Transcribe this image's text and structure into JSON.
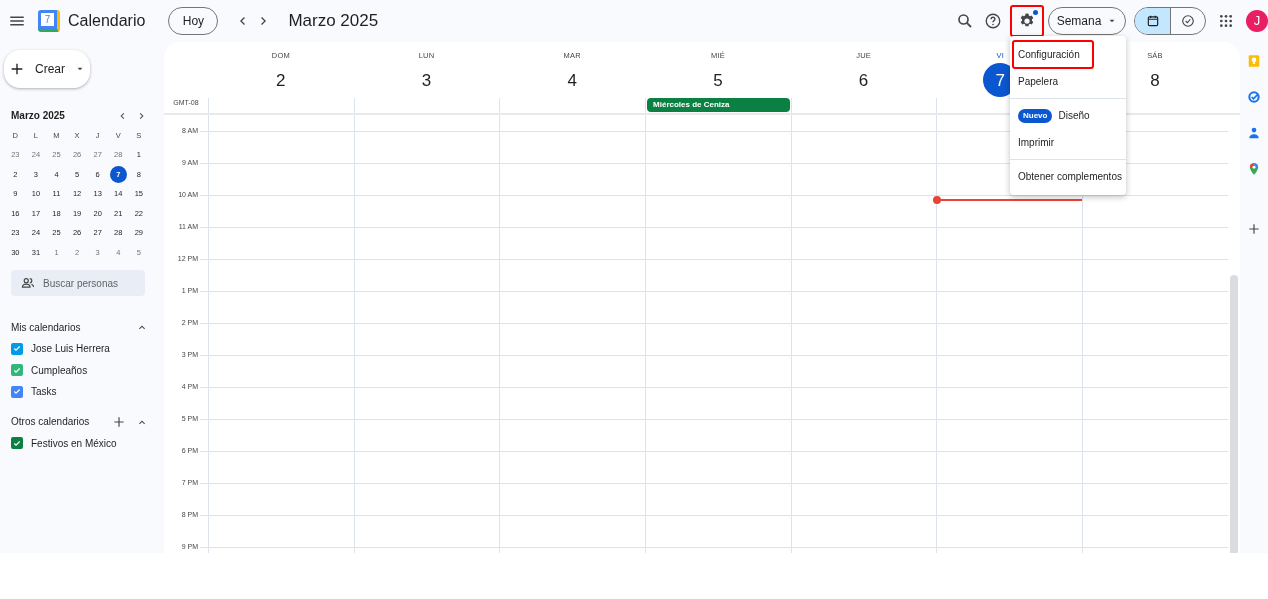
{
  "app": {
    "title": "Calendario",
    "logo_digit": "7"
  },
  "toolbar": {
    "today_button": "Hoy",
    "period_title": "Marzo 2025",
    "view_selector": "Semana",
    "settings_highlighted": true,
    "settings_badge": true,
    "avatar_letter": "J",
    "view_toggle": [
      {
        "kind": "calendar",
        "selected": true
      },
      {
        "kind": "tasks",
        "selected": false
      }
    ]
  },
  "sidebar": {
    "create_button": "Crear",
    "mini_calendar": {
      "title": "Marzo 2025",
      "weekdays": [
        "D",
        "L",
        "M",
        "X",
        "J",
        "V",
        "S"
      ],
      "weeks": [
        [
          {
            "day": "23",
            "muted": true,
            "selected": false
          },
          {
            "day": "24",
            "muted": true,
            "selected": false
          },
          {
            "day": "25",
            "muted": true,
            "selected": false
          },
          {
            "day": "26",
            "muted": true,
            "selected": false
          },
          {
            "day": "27",
            "muted": true,
            "selected": false
          },
          {
            "day": "28",
            "muted": true,
            "selected": false
          },
          {
            "day": "1",
            "muted": false,
            "selected": false
          }
        ],
        [
          {
            "day": "2",
            "muted": false,
            "selected": false
          },
          {
            "day": "3",
            "muted": false,
            "selected": false
          },
          {
            "day": "4",
            "muted": false,
            "selected": false
          },
          {
            "day": "5",
            "muted": false,
            "selected": false
          },
          {
            "day": "6",
            "muted": false,
            "selected": false
          },
          {
            "day": "7",
            "muted": false,
            "selected": true
          },
          {
            "day": "8",
            "muted": false,
            "selected": false
          }
        ],
        [
          {
            "day": "9",
            "muted": false,
            "selected": false
          },
          {
            "day": "10",
            "muted": false,
            "selected": false
          },
          {
            "day": "11",
            "muted": false,
            "selected": false
          },
          {
            "day": "12",
            "muted": false,
            "selected": false
          },
          {
            "day": "13",
            "muted": false,
            "selected": false
          },
          {
            "day": "14",
            "muted": false,
            "selected": false
          },
          {
            "day": "15",
            "muted": false,
            "selected": false
          }
        ],
        [
          {
            "day": "16",
            "muted": false,
            "selected": false
          },
          {
            "day": "17",
            "muted": false,
            "selected": false
          },
          {
            "day": "18",
            "muted": false,
            "selected": false
          },
          {
            "day": "19",
            "muted": false,
            "selected": false
          },
          {
            "day": "20",
            "muted": false,
            "selected": false
          },
          {
            "day": "21",
            "muted": false,
            "selected": false
          },
          {
            "day": "22",
            "muted": false,
            "selected": false
          }
        ],
        [
          {
            "day": "23",
            "muted": false,
            "selected": false
          },
          {
            "day": "24",
            "muted": false,
            "selected": false
          },
          {
            "day": "25",
            "muted": false,
            "selected": false
          },
          {
            "day": "26",
            "muted": false,
            "selected": false
          },
          {
            "day": "27",
            "muted": false,
            "selected": false
          },
          {
            "day": "28",
            "muted": false,
            "selected": false
          },
          {
            "day": "29",
            "muted": false,
            "selected": false
          }
        ],
        [
          {
            "day": "30",
            "muted": false,
            "selected": false
          },
          {
            "day": "31",
            "muted": false,
            "selected": false
          },
          {
            "day": "1",
            "muted": true,
            "selected": false
          },
          {
            "day": "2",
            "muted": true,
            "selected": false
          },
          {
            "day": "3",
            "muted": true,
            "selected": false
          },
          {
            "day": "4",
            "muted": true,
            "selected": false
          },
          {
            "day": "5",
            "muted": true,
            "selected": false
          }
        ]
      ]
    },
    "search_people": {
      "placeholder": "Buscar personas"
    },
    "sections": [
      {
        "title": "Mis calendarios",
        "expanded": true,
        "can_add": false,
        "calendars": [
          {
            "name": "Jose Luis Herrera",
            "checked": true,
            "color": "#039be5"
          },
          {
            "name": "Cumpleaños",
            "checked": true,
            "color": "#33b679"
          },
          {
            "name": "Tasks",
            "checked": true,
            "color": "#4285f4"
          }
        ]
      },
      {
        "title": "Otros calendarios",
        "expanded": true,
        "can_add": true,
        "calendars": [
          {
            "name": "Festivos en México",
            "checked": true,
            "color": "#0b8043"
          }
        ]
      }
    ]
  },
  "week": {
    "timezone": "GMT-08",
    "days": [
      {
        "label": "DOM",
        "date": "2",
        "today": false
      },
      {
        "label": "LUN",
        "date": "3",
        "today": false
      },
      {
        "label": "MAR",
        "date": "4",
        "today": false
      },
      {
        "label": "MIÉ",
        "date": "5",
        "today": false,
        "all_day_events": [
          {
            "title": "Miércoles de Ceniza",
            "color": "#0b8043"
          }
        ]
      },
      {
        "label": "JUE",
        "date": "6",
        "today": false
      },
      {
        "label": "VI",
        "date": "7",
        "today": true,
        "now_line": true
      },
      {
        "label": "SÁB",
        "date": "8",
        "today": false
      }
    ],
    "hours": [
      "8 AM",
      "9 AM",
      "10 AM",
      "11 AM",
      "12 PM",
      "1 PM",
      "2 PM",
      "3 PM",
      "4 PM",
      "5 PM",
      "6 PM",
      "7 PM",
      "8 PM",
      "9 PM"
    ]
  },
  "settings_menu": {
    "groups": [
      [
        {
          "label": "Configuración",
          "highlighted": true
        },
        {
          "label": "Papelera",
          "highlighted": false
        }
      ],
      [
        {
          "label": "Diseño",
          "badge": "Nuevo",
          "highlighted": false
        },
        {
          "label": "Imprimir",
          "highlighted": false
        }
      ],
      [
        {
          "label": "Obtener complementos",
          "highlighted": false
        }
      ]
    ]
  },
  "side_panel": [
    {
      "kind": "keep"
    },
    {
      "kind": "tasks"
    },
    {
      "kind": "contacts"
    },
    {
      "kind": "maps"
    }
  ]
}
